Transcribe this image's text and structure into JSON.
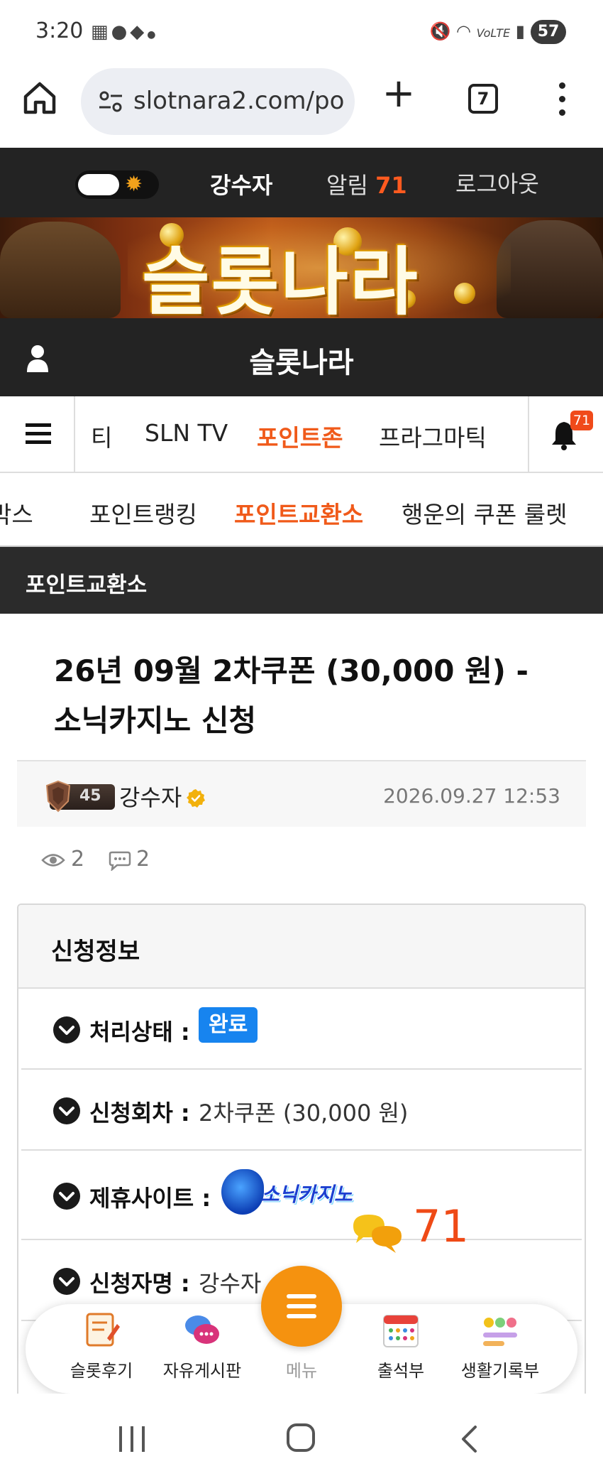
{
  "status_bar": {
    "time": "3:20",
    "left_icons": [
      "calendar-icon",
      "message-icon",
      "app-icon",
      "dot-icon"
    ],
    "right_icons": [
      "mute-icon",
      "wifi-icon",
      "volte-icon",
      "signal-icon"
    ],
    "battery": "57"
  },
  "browser": {
    "url": "slotnara2.com/po",
    "tab_count": "7"
  },
  "topbar": {
    "username": "강수자",
    "alarm_label": "알림",
    "alarm_count": "71",
    "logout": "로그아웃"
  },
  "banner": {
    "logo_text": "슬롯나라"
  },
  "site_header": {
    "title": "슬롯나라"
  },
  "main_nav": {
    "items": [
      "티",
      "SLN TV",
      "포인트존",
      "프라그마틱"
    ],
    "active_index": 2,
    "bell_badge": "71"
  },
  "sub_nav": {
    "items": [
      "박스",
      "포인트랭킹",
      "포인트교환소",
      "행운의 쿠폰 룰렛"
    ],
    "active_index": 2
  },
  "board": {
    "title": "포인트교환소"
  },
  "post": {
    "title": "26년 09월 2차쿠폰 (30,000 원) - 소닉카지노 신청",
    "level": "45",
    "author": "강수자",
    "date": "2026.09.27 12:53",
    "views": "2",
    "comments": "2"
  },
  "info_panel": {
    "heading": "신청정보",
    "rows": [
      {
        "label": "처리상태 :",
        "value": "완료"
      },
      {
        "label": "신청회차 :",
        "value": "2차쿠폰 (30,000 원)"
      },
      {
        "label": "제휴사이트 :",
        "value": "소닉카지노"
      },
      {
        "label": "신청자명 :",
        "value": "강수자"
      }
    ]
  },
  "chat_float": {
    "count": "71"
  },
  "dock": {
    "items": [
      {
        "label": "슬롯후기",
        "icon": "review-icon"
      },
      {
        "label": "자유게시판",
        "icon": "chat-bubbles-icon"
      },
      {
        "label": "메뉴",
        "icon": "menu-icon"
      },
      {
        "label": "출석부",
        "icon": "calendar-icon"
      },
      {
        "label": "생활기록부",
        "icon": "emoji-record-icon"
      }
    ]
  },
  "colors": {
    "accent": "#f05a1a",
    "dark_bar": "#232323",
    "badge_blue": "#1784ef",
    "fab": "#f5920f"
  }
}
